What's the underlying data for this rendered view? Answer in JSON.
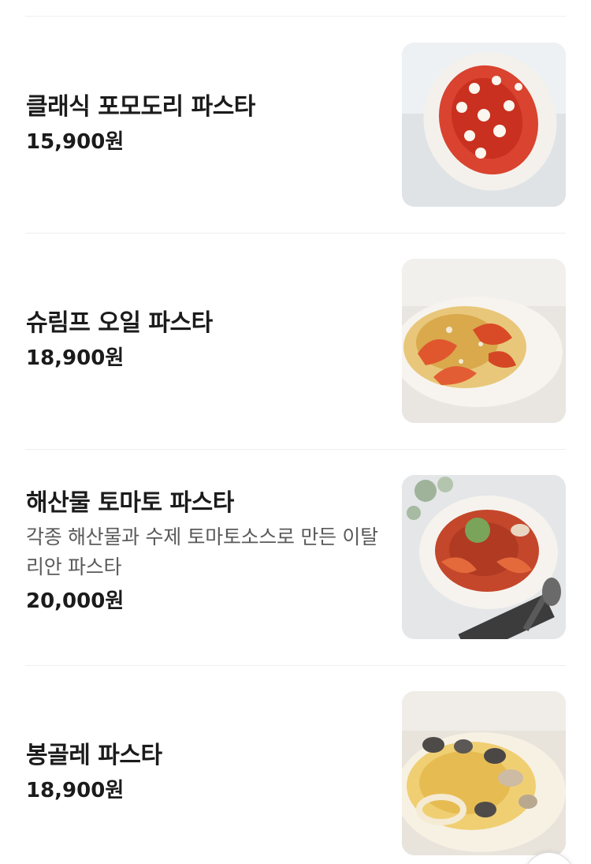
{
  "menu": {
    "items": [
      {
        "name": "클래식 포모도리 파스타",
        "price": "15,900원",
        "photo_icon": "tomato-pasta-photo"
      },
      {
        "name": "슈림프 오일 파스타",
        "price": "18,900원",
        "photo_icon": "shrimp-pasta-photo"
      },
      {
        "name": "해산물 토마토 파스타",
        "description": "각종 해산물과 수제 토마토소스로 만든 이탈리안 파스타",
        "price": "20,000원",
        "photo_icon": "seafood-pasta-photo"
      },
      {
        "name": "봉골레 파스타",
        "price": "18,900원",
        "photo_icon": "vongole-pasta-photo"
      }
    ]
  },
  "colors": {
    "text": "#1b1b1b",
    "description": "#5a5a5a",
    "divider": "#eeeeee"
  }
}
